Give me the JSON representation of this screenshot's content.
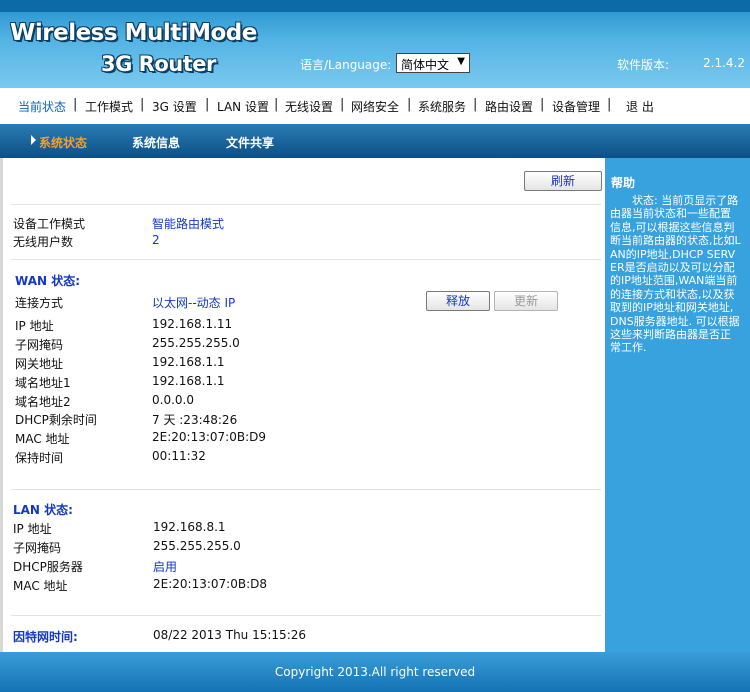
{
  "header": {
    "logo_line1": "Wireless MultiMode",
    "logo_line2": "3G Router",
    "language_label": "语言/Language:",
    "language_selected": "简体中文",
    "version_label": "软件版本:",
    "version_value": "2.1.4.2"
  },
  "nav": {
    "items": [
      "当前状态",
      "工作模式",
      "3G 设置",
      "LAN 设置",
      "无线设置",
      "网络安全",
      "系统服务",
      "路由设置",
      "设备管理",
      "退 出"
    ],
    "active": "当前状态"
  },
  "subnav": {
    "items": [
      "系统状态",
      "系统信息",
      "文件共享"
    ],
    "active": "系统状态"
  },
  "content": {
    "refresh_label": "刷新",
    "device": {
      "mode_label": "设备工作模式",
      "mode_value": "智能路由模式",
      "users_label": "无线用户数",
      "users_value": "2"
    },
    "wan": {
      "title": "WAN 状态:",
      "conn_label": "连接方式",
      "conn_value": "以太网--动态 IP",
      "release_label": "释放",
      "renew_label": "更新",
      "rows": [
        {
          "label": "IP 地址",
          "value": "192.168.1.11"
        },
        {
          "label": "子网掩码",
          "value": "255.255.255.0"
        },
        {
          "label": "网关地址",
          "value": "192.168.1.1"
        },
        {
          "label": "域名地址1",
          "value": "192.168.1.1"
        },
        {
          "label": "域名地址2",
          "value": "0.0.0.0"
        },
        {
          "label": "DHCP剩余时间",
          "value": "7 天 :23:48:26"
        },
        {
          "label": "MAC 地址",
          "value": "2E:20:13:07:0B:D9"
        },
        {
          "label": "保持时间",
          "value": "00:11:32"
        }
      ]
    },
    "lan": {
      "title": "LAN 状态:",
      "rows": [
        {
          "label": "IP 地址",
          "value": "192.168.8.1"
        },
        {
          "label": "子网掩码",
          "value": "255.255.255.0"
        },
        {
          "label": "DHCP服务器",
          "value": "启用"
        },
        {
          "label": "MAC 地址",
          "value": "2E:20:13:07:0B:D8"
        }
      ]
    },
    "time": {
      "label": "因特网时间:",
      "value": "08/22 2013 Thu 15:15:26"
    }
  },
  "help": {
    "title": "帮助",
    "text": "状态: 当前页显示了路由器当前状态和一些配置信息,可以根据这些信息判断当前路由器的状态,比如LAN的IP地址,DHCP SERVER是否启动以及可以分配的IP地址范围,WAN端当前的连接方式和状态,以及获取到的IP地址和网关地址,DNS服务器地址. 可以根据这些来判断路由器是否正常工作."
  },
  "footer": {
    "copyright": "Copyright 2013.All right reserved"
  },
  "colors": {
    "accent_blue": "#1339c2",
    "subnav_active": "#f0a030",
    "help_bg": "#38a2de"
  }
}
